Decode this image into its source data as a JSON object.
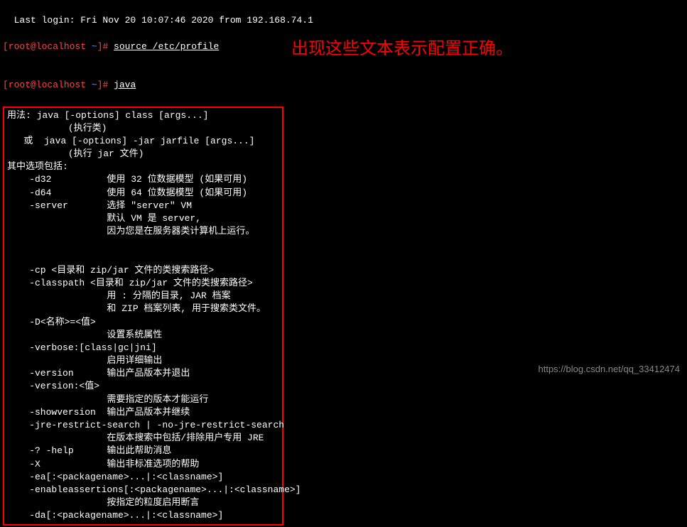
{
  "login_info": "Last login: Fri Nov 20 10:07:46 2020 from 192.168.74.1",
  "prompt1": {
    "user_host": "[root@localhost ",
    "tilde": "~",
    "suffix": "]# ",
    "command": "source /etc/profile"
  },
  "prompt2": {
    "user_host": "[root@localhost ",
    "tilde": "~",
    "suffix": "]# ",
    "command": "java"
  },
  "java_output": [
    "用法: java [-options] class [args...]",
    "           (执行类)",
    "   或  java [-options] -jar jarfile [args...]",
    "           (执行 jar 文件)",
    "其中选项包括:",
    "    -d32          使用 32 位数据模型 (如果可用)",
    "    -d64          使用 64 位数据模型 (如果可用)",
    "    -server       选择 \"server\" VM",
    "                  默认 VM 是 server,",
    "                  因为您是在服务器类计算机上运行。",
    "",
    "",
    "    -cp <目录和 zip/jar 文件的类搜索路径>",
    "    -classpath <目录和 zip/jar 文件的类搜索路径>",
    "                  用 : 分隔的目录, JAR 档案",
    "                  和 ZIP 档案列表, 用于搜索类文件。",
    "    -D<名称>=<值>",
    "                  设置系统属性",
    "    -verbose:[class|gc|jni]",
    "                  启用详细输出",
    "    -version      输出产品版本并退出",
    "    -version:<值>",
    "                  需要指定的版本才能运行",
    "    -showversion  输出产品版本并继续",
    "    -jre-restrict-search | -no-jre-restrict-search",
    "                  在版本搜索中包括/排除用户专用 JRE",
    "    -? -help      输出此帮助消息",
    "    -X            输出非标准选项的帮助",
    "    -ea[:<packagename>...|:<classname>]",
    "    -enableassertions[:<packagename>...|:<classname>]",
    "                  按指定的粒度启用断言",
    "    -da[:<packagename>...|:<classname>]"
  ],
  "annotation_text": "出现这些文本表示配置正确。",
  "watermark_text": "https://blog.csdn.net/qq_33412474"
}
